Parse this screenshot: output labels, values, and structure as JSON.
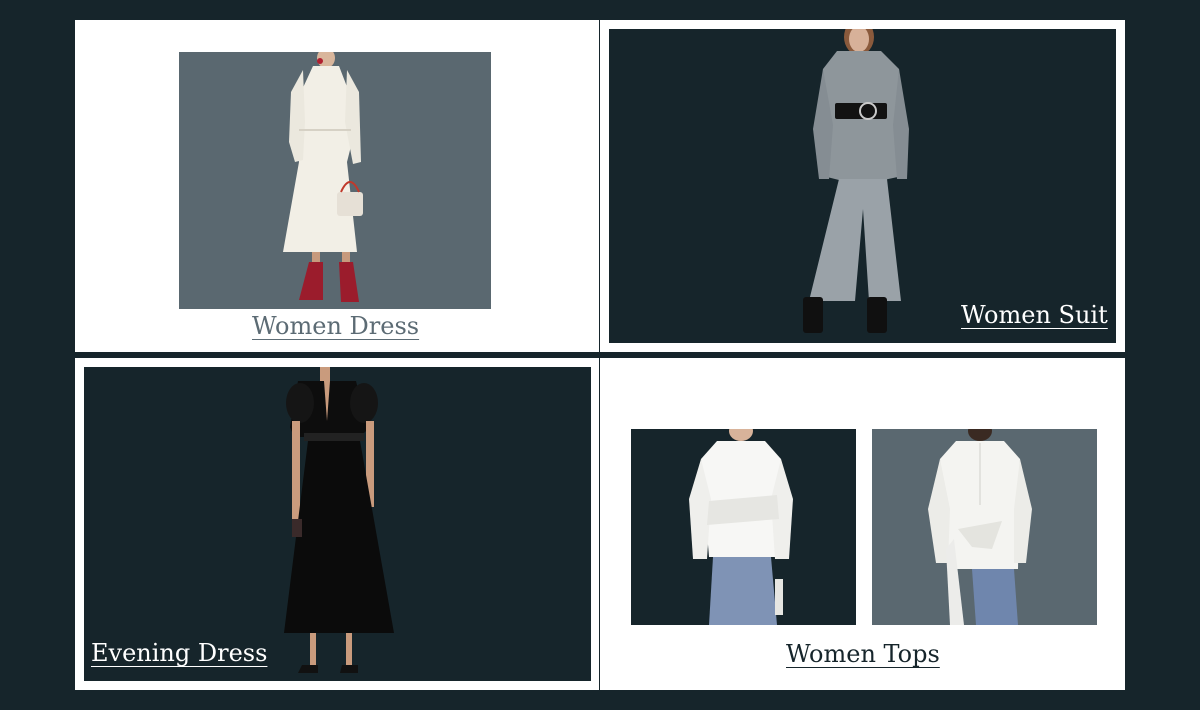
{
  "colors": {
    "page_background": "#16252b",
    "panel_background": "#ffffff",
    "slate_photo_background": "#5a6870",
    "dark_photo_background": "#16252b"
  },
  "tiles": {
    "women_dress": {
      "label": "Women Dress",
      "image": "model-white-dress-image"
    },
    "women_suit": {
      "label": "Women Suit",
      "image": "model-grey-suit-image"
    },
    "evening_dress": {
      "label": "Evening Dress",
      "image": "model-black-evening-dress-image"
    },
    "women_tops": {
      "label": "Women Tops",
      "images": [
        "white-top-front-image",
        "white-top-back-image"
      ]
    }
  }
}
